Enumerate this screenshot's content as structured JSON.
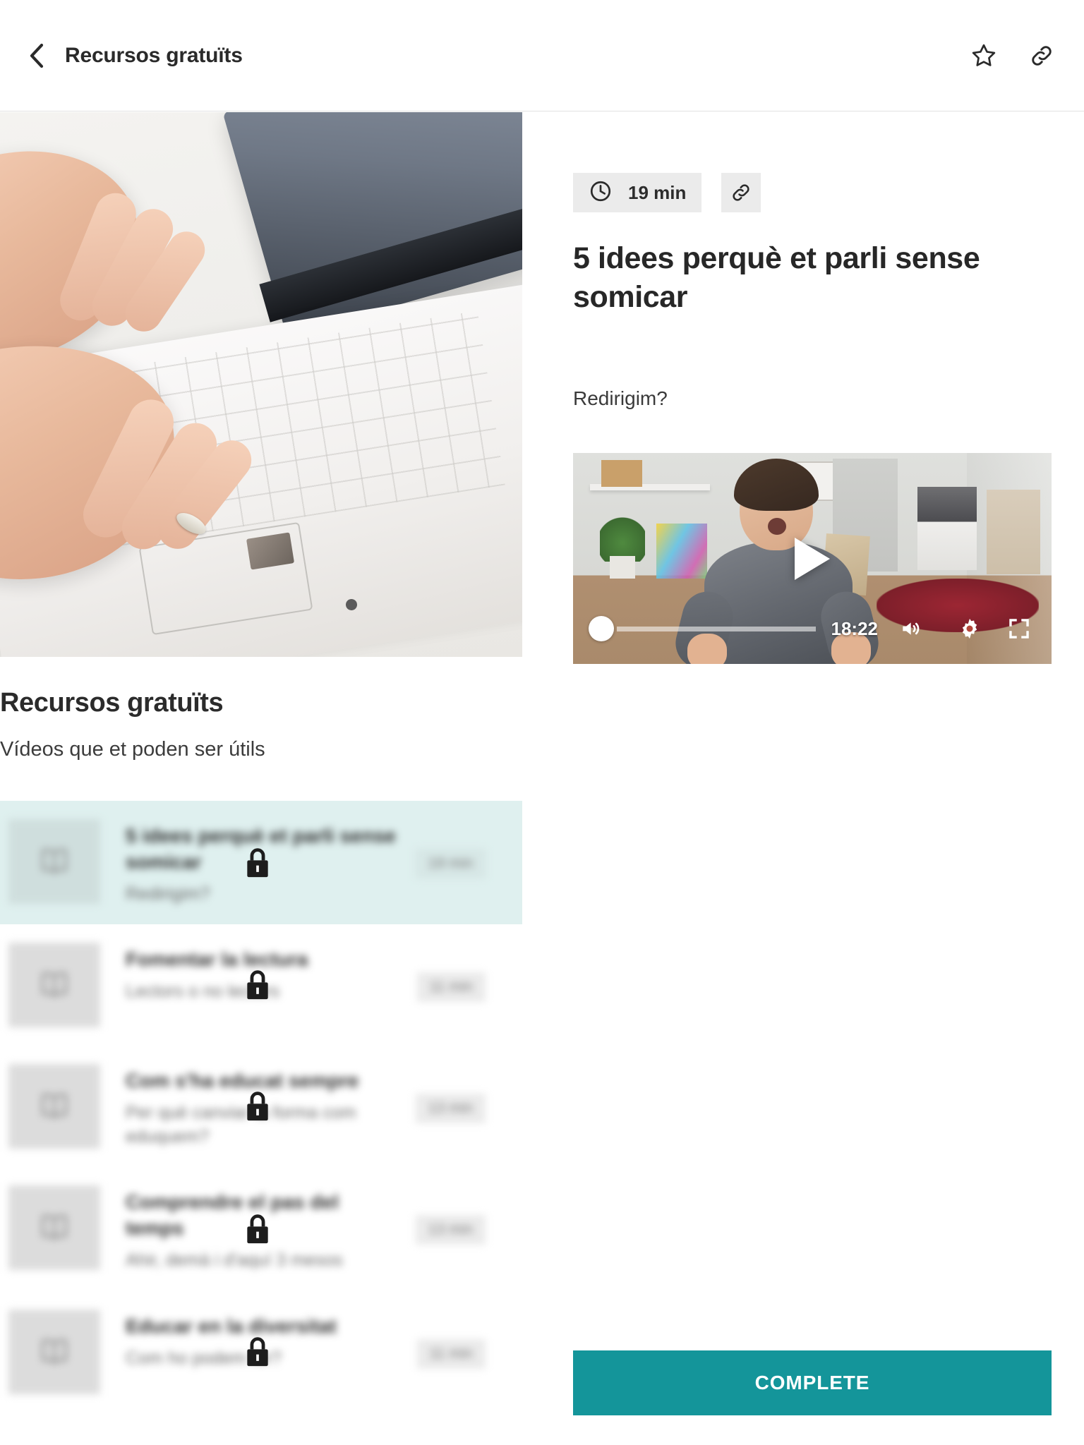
{
  "header": {
    "back_icon": "chevron-left-icon",
    "title": "Recursos gratuïts",
    "favorite_icon": "star-icon",
    "share_icon": "link-icon"
  },
  "left_panel": {
    "hero_image_alt": "hands typing on white laptop keyboard",
    "title": "Recursos gratuïts",
    "subtitle": "Vídeos que et poden ser útils",
    "lessons": [
      {
        "name": "5 idees perquè et parli sense somicar",
        "description": "Redirigim?",
        "duration": "19 min",
        "locked": true,
        "active": true,
        "icon": "book-icon",
        "lock_icon": "lock-icon"
      },
      {
        "name": "Fomentar la lectura",
        "description": "Lectors o no lectors",
        "duration": "11 min",
        "locked": true,
        "active": false,
        "icon": "book-icon",
        "lock_icon": "lock-icon"
      },
      {
        "name": "Com s'ha educat sempre",
        "description": "Per què canviar la forma com eduquem?",
        "duration": "13 min",
        "locked": true,
        "active": false,
        "icon": "book-icon",
        "lock_icon": "lock-icon"
      },
      {
        "name": "Comprendre el pas del temps",
        "description": "Ahir, demà i d'aquí 3 mesos",
        "duration": "13 min",
        "locked": true,
        "active": false,
        "icon": "book-icon",
        "lock_icon": "lock-icon"
      },
      {
        "name": "Educar en la diversitat",
        "description": "Com ho podem fer?",
        "duration": "11 min",
        "locked": true,
        "active": false,
        "icon": "book-icon",
        "lock_icon": "lock-icon"
      }
    ]
  },
  "right_panel": {
    "duration_label": "19 min",
    "clock_icon": "clock-icon",
    "link_icon": "link-icon",
    "title": "5 idees perquè et parli sense somicar",
    "subtitle": "Redirigim?",
    "video": {
      "play_icon": "play-icon",
      "time_remaining": "18:22",
      "volume_icon": "volume-icon",
      "settings_icon": "gear-icon",
      "fullscreen_icon": "fullscreen-icon",
      "progress_percent": 0
    },
    "complete_button": "COMPLETE"
  },
  "colors": {
    "accent": "#14959a",
    "active_row": "#dff0ef",
    "chip_bg": "#ebebeb",
    "text_primary": "#2b2b2b",
    "text_secondary": "#6a6a6a"
  }
}
